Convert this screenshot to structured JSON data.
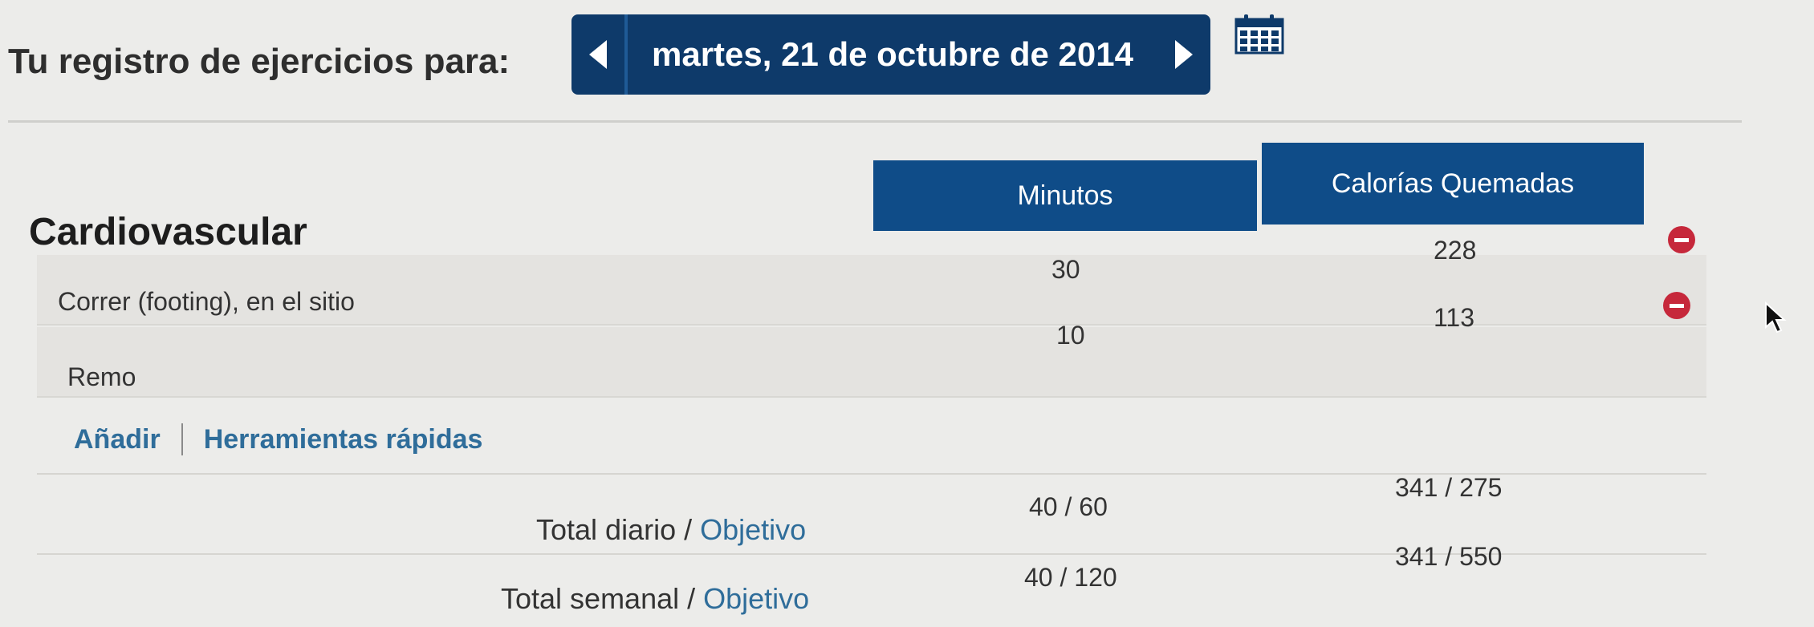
{
  "header": {
    "title": "Tu registro de ejercicios para:",
    "date": "martes, 21 de octubre de 2014"
  },
  "table": {
    "section": "Cardiovascular",
    "columns": [
      "Minutos",
      "Calorías Quemadas"
    ],
    "rows": [
      {
        "name": "Correr (footing), en el sitio",
        "minutes": "30",
        "calories": "228"
      },
      {
        "name": "Remo",
        "minutes": "10",
        "calories": "113"
      }
    ]
  },
  "actions": {
    "add": "Añadir",
    "quick_tools": "Herramientas rápidas"
  },
  "totals": {
    "daily": {
      "label_prefix": "Total diario / ",
      "label_goal": "Objetivo",
      "minutes": "40 / 60",
      "calories": "341 / 275"
    },
    "weekly": {
      "label_prefix": "Total semanal / ",
      "label_goal": "Objetivo",
      "minutes": "40 / 120",
      "calories": "341 / 550"
    }
  },
  "colors": {
    "nav_background": "#0e3a6a",
    "header_background": "#0f4c88",
    "link": "#2f6d9a",
    "remove": "#c6283b"
  },
  "icons": [
    "arrow-left-icon",
    "arrow-right-icon",
    "calendar-icon",
    "remove-icon",
    "mouse-cursor-icon"
  ]
}
